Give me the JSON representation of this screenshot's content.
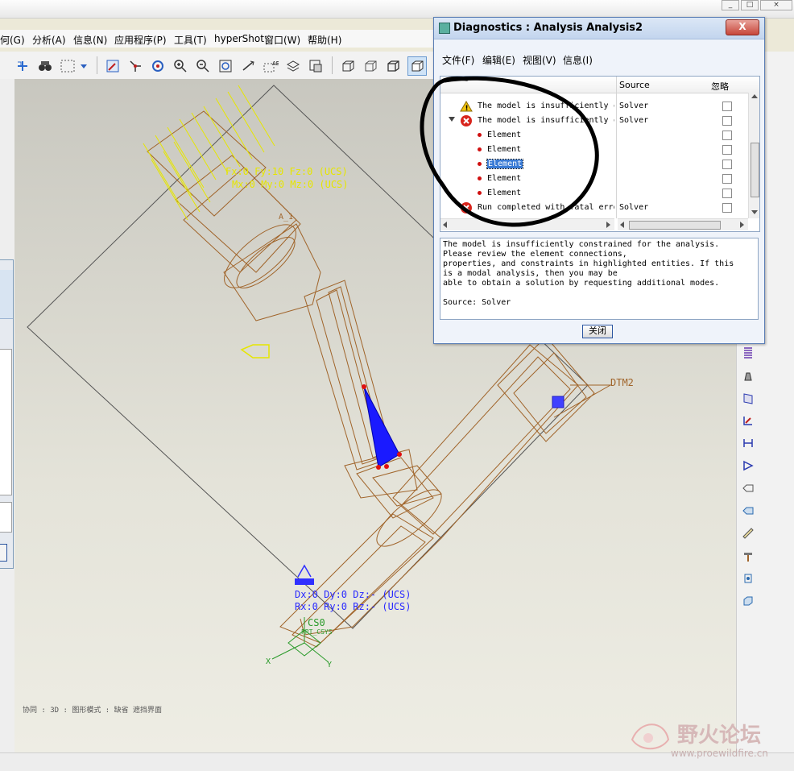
{
  "app": {
    "menu": [
      "何(G)",
      "分析(A)",
      "信息(N)",
      "应用程序(P)",
      "工具(T)",
      "hyperShot",
      "窗口(W)",
      "帮助(H)"
    ]
  },
  "viewport": {
    "load_label_1": "Fx:0 Fy:10 Fz:0 (UCS)",
    "load_label_2": "Mx:0 My:0 Mz:0 (UCS)",
    "constraint_label_1": "Dx:0 Dy:0 Dz:- (UCS)",
    "constraint_label_2": "Rx:0 Ry:0 Rz:- (UCS)",
    "datum_dtm2": "DTM2",
    "datum_a1": "A_1",
    "csys_label": "CS0",
    "csys_sub": "PRT_CSYS",
    "axis_x": "X",
    "axis_y": "Y",
    "status_text": "协同 : 3D : 图形模式 : 缺省 遮挡界面"
  },
  "dialog": {
    "title": "Diagnostics : Analysis Analysis2",
    "close_x": "X",
    "menu": [
      "文件(F)",
      "编辑(E)",
      "视图(V)",
      "信息(I)"
    ],
    "columns": {
      "source": "Source",
      "ignore": "忽略"
    },
    "rows": [
      {
        "text": "The model is insufficiently constrained",
        "source": "Solver",
        "type": "warning"
      },
      {
        "text": "The model is insufficiently constrained",
        "source": "Solver",
        "type": "error"
      },
      {
        "text": "Element",
        "source": "",
        "type": "child"
      },
      {
        "text": "Element",
        "source": "",
        "type": "child"
      },
      {
        "text": "Element",
        "source": "",
        "type": "child-selected"
      },
      {
        "text": "Element",
        "source": "",
        "type": "child"
      },
      {
        "text": "Element",
        "source": "",
        "type": "child"
      },
      {
        "text": "Run completed with fatal errors",
        "source": "Solver",
        "type": "error"
      }
    ],
    "details": [
      "The model is insufficiently constrained for the analysis.",
      "Please review the element connections,",
      "properties, and constraints in highlighted entities. If this",
      "is a modal analysis, then you may be",
      "able to obtain a solution by requesting additional modes.",
      "",
      "Source: Solver"
    ],
    "close_button": "关闭"
  },
  "watermark": {
    "brand": "野火论坛",
    "url": "www.proewildfire.cn"
  },
  "colors": {
    "load": "#e6e600",
    "model": "#a0642a",
    "constraint": "#2a2aff",
    "csys": "#2a9a2a"
  }
}
